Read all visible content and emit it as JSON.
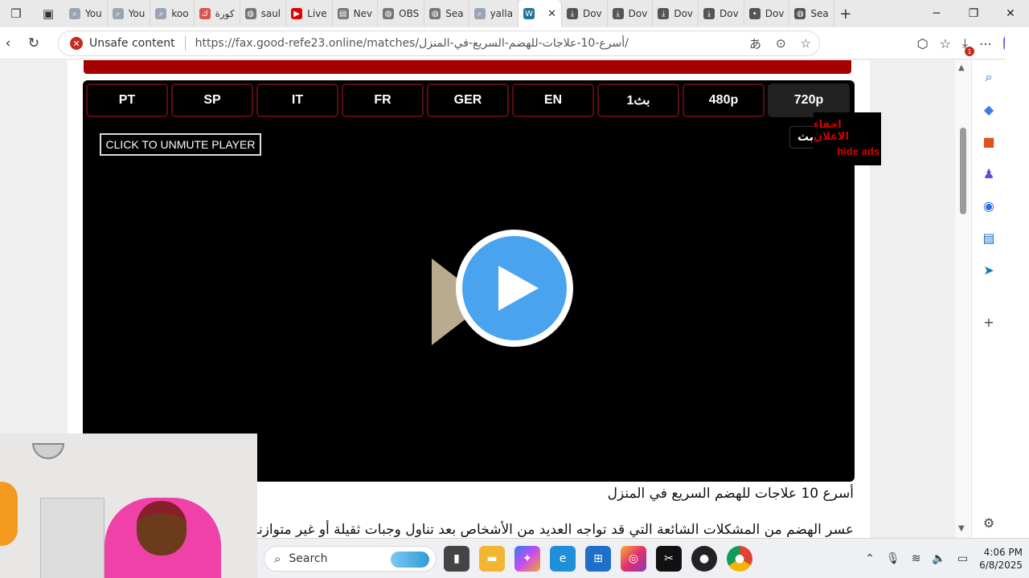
{
  "tabs": [
    {
      "label": "You",
      "icon": "search-icon",
      "fav_color": "#9aa4b2"
    },
    {
      "label": "You",
      "icon": "search-icon",
      "fav_color": "#9aa4b2"
    },
    {
      "label": "koo",
      "icon": "search-icon",
      "fav_color": "#9aa4b2"
    },
    {
      "label": "كورة",
      "icon": "koora-icon",
      "fav_color": "#d9534f"
    },
    {
      "label": "saul",
      "icon": "globe-icon",
      "fav_color": "#777777"
    },
    {
      "label": "Live",
      "icon": "youtube-icon",
      "fav_color": "#e00000"
    },
    {
      "label": "Nev",
      "icon": "page-icon",
      "fav_color": "#777777"
    },
    {
      "label": "OBS",
      "icon": "globe-icon",
      "fav_color": "#777777"
    },
    {
      "label": "Sea",
      "icon": "globe-icon",
      "fav_color": "#777777"
    },
    {
      "label": "yalla",
      "icon": "search-icon",
      "fav_color": "#9aa4b2"
    },
    {
      "label": "",
      "icon": "wordpress-icon",
      "fav_color": "#21759b",
      "active": true
    },
    {
      "label": "Dov",
      "icon": "download-icon",
      "fav_color": "#555555"
    },
    {
      "label": "Dov",
      "icon": "download-icon",
      "fav_color": "#555555"
    },
    {
      "label": "Dov",
      "icon": "download-icon",
      "fav_color": "#555555"
    },
    {
      "label": "Dov",
      "icon": "download-icon",
      "fav_color": "#555555"
    },
    {
      "label": "Dov",
      "icon": "dot-icon",
      "fav_color": "#555555"
    },
    {
      "label": "Sea",
      "icon": "globe-icon",
      "fav_color": "#555555"
    }
  ],
  "address": {
    "security_label": "Unsafe content",
    "url": "https://fax.good-refe23.online/matches/أسرع-10-علاجات-للهضم-السريع-في-المنزل/"
  },
  "player": {
    "quality_buttons": [
      "PT",
      "SP",
      "IT",
      "FR",
      "GER",
      "EN",
      "بث1",
      "480p",
      "720p"
    ],
    "selected": "720p",
    "unmute_label": "CLICK TO UNMUTE PLAYER",
    "hide_ads_ar": "اخفاء الاعلان",
    "hide_ads_en": "hide ads",
    "live_pill": "بث"
  },
  "article": {
    "title": "أسرع 10 علاجات للهضم السريع في المنزل",
    "paragraph": "عسر الهضم من المشكلات الشائعة التي قد تواجه العديد من الأشخاص بعد تناول وجبات ثقيلة أو غير متوازنة"
  },
  "taskbar": {
    "search_placeholder": "Search",
    "time": "4:06 PM",
    "date": "6/8/2025"
  },
  "colors": {
    "play_blue": "#4aa3ee",
    "banner_red": "#a30000",
    "ads_red": "#d40000",
    "unsafe_red": "#c42b1c"
  }
}
